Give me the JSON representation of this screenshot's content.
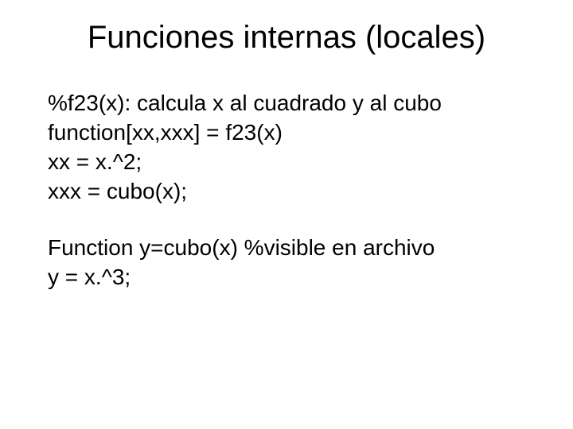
{
  "title": "Funciones internas (locales)",
  "lines": {
    "l1": "%f23(x): calcula x al cuadrado y al cubo",
    "l2": "function[xx,xxx] = f23(x)",
    "l3": "xx = x.^2;",
    "l4": "xxx = cubo(x);",
    "l5": "Function y=cubo(x) %visible en archivo",
    "l6": "y = x.^3;"
  }
}
